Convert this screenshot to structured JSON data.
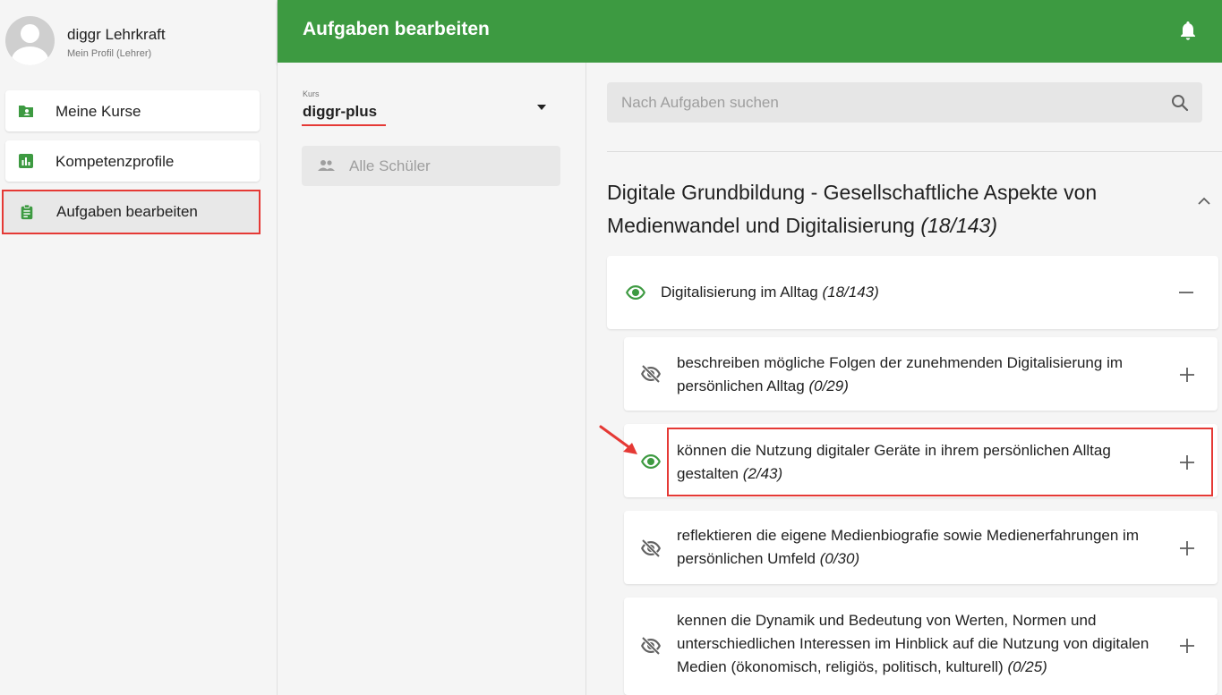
{
  "profile": {
    "name": "diggr Lehrkraft",
    "role": "Mein Profil (Lehrer)"
  },
  "sidebar": {
    "items": [
      {
        "label": "Meine Kurse",
        "icon": "folder-account-icon"
      },
      {
        "label": "Kompetenzprofile",
        "icon": "chart-box-icon"
      },
      {
        "label": "Aufgaben bearbeiten",
        "icon": "clipboard-text-icon",
        "active": true
      }
    ]
  },
  "header": {
    "title": "Aufgaben bearbeiten",
    "icon": "bell-icon"
  },
  "course": {
    "label": "Kurs",
    "value": "diggr-plus"
  },
  "students": {
    "label": "Alle Schüler",
    "icon": "account-group-icon"
  },
  "search": {
    "placeholder": "Nach Aufgaben suchen"
  },
  "section": {
    "title": "Digitale Grundbildung - Gesellschaftliche Aspekte von Medienwandel und Digitalisierung",
    "count": "(18/143)"
  },
  "subsection": {
    "title": "Digitalisierung im Alltag",
    "count": "(18/143)",
    "visible": true
  },
  "competencies": [
    {
      "text": "beschreiben mögliche Folgen der zunehmenden Digitalisierung im persönlichen Alltag",
      "count": "(0/29)",
      "visible": false
    },
    {
      "text": "können die Nutzung digitaler Geräte in ihrem persönlichen Alltag gestalten",
      "count": "(2/43)",
      "visible": true
    },
    {
      "text": "reflektieren die eigene Medienbiografie sowie Medienerfahrungen im persönlichen Umfeld",
      "count": "(0/30)",
      "visible": false
    },
    {
      "text": "kennen die Dynamik und Bedeutung von Werten, Normen und unterschiedlichen Interessen im Hinblick auf die Nutzung von digitalen Medien (ökonomisch, religiös, politisch, kulturell)",
      "count": "(0/25)",
      "visible": false
    }
  ],
  "colors": {
    "primary": "#3d9a41",
    "highlight": "#e53935",
    "icon_gray": "#616161"
  }
}
